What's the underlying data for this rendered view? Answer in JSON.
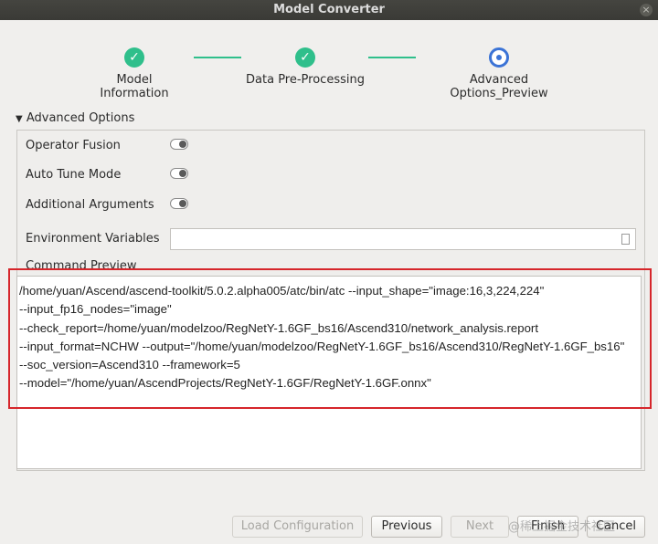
{
  "window": {
    "title": "Model Converter",
    "close_glyph": "×"
  },
  "steps": [
    {
      "label": "Model Information",
      "state": "done"
    },
    {
      "label": "Data Pre-Processing",
      "state": "done"
    },
    {
      "label": "Advanced Options_Preview",
      "state": "current"
    }
  ],
  "advanced": {
    "toggle_glyph": "▼",
    "title": "Advanced Options",
    "operator_fusion": "Operator Fusion",
    "auto_tune": "Auto Tune Mode",
    "additional_args": "Additional Arguments",
    "env_vars": "Environment Variables"
  },
  "command_preview": {
    "label": "Command Preview",
    "lines": [
      "/home/yuan/Ascend/ascend-toolkit/5.0.2.alpha005/atc/bin/atc  --input_shape=\"image:16,3,224,224\"",
      "--input_fp16_nodes=\"image\"",
      "--check_report=/home/yuan/modelzoo/RegNetY-1.6GF_bs16/Ascend310/network_analysis.report",
      "--input_format=NCHW --output=\"/home/yuan/modelzoo/RegNetY-1.6GF_bs16/Ascend310/RegNetY-1.6GF_bs16\"",
      "--soc_version=Ascend310 --framework=5",
      "--model=\"/home/yuan/AscendProjects/RegNetY-1.6GF/RegNetY-1.6GF.onnx\""
    ]
  },
  "buttons": {
    "load_configuration": "Load Configuration",
    "previous": "Previous",
    "next": "Next",
    "finish": "Finish",
    "cancel": "Cancel"
  },
  "watermark": "@稀土掘金技术社区",
  "colors": {
    "done": "#2fbf8b",
    "current": "#3b73d6",
    "highlight": "#d6262b"
  }
}
